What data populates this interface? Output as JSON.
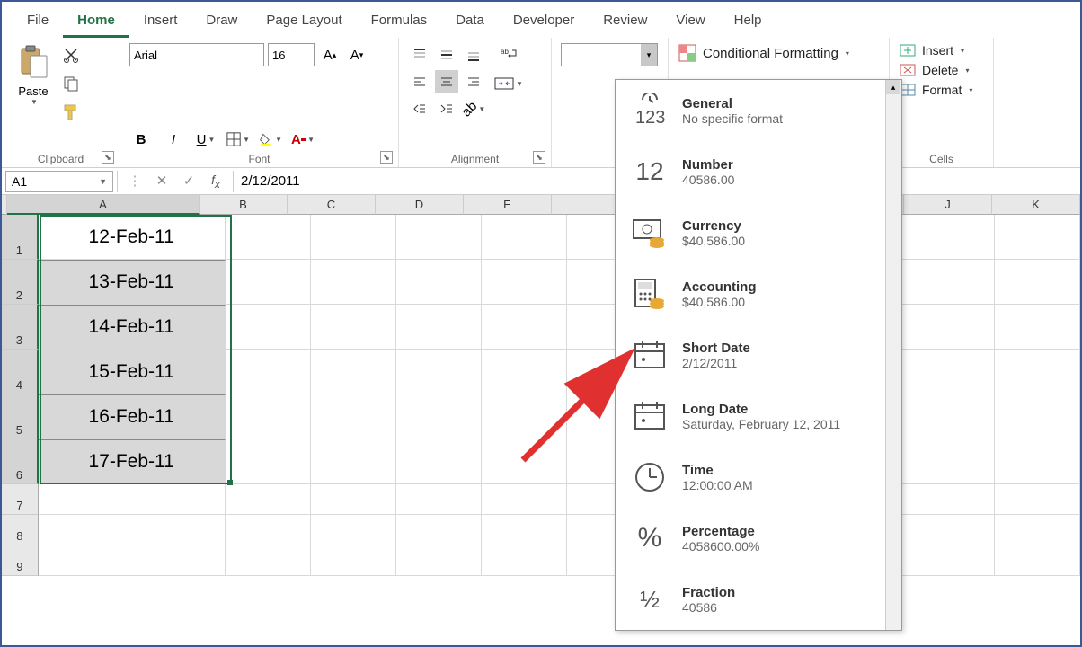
{
  "ribbon_tabs": [
    "File",
    "Home",
    "Insert",
    "Draw",
    "Page Layout",
    "Formulas",
    "Data",
    "Developer",
    "Review",
    "View",
    "Help"
  ],
  "active_tab": "Home",
  "clipboard": {
    "paste_label": "Paste",
    "group_label": "Clipboard"
  },
  "font": {
    "name": "Arial",
    "size": "16",
    "group_label": "Font"
  },
  "alignment": {
    "group_label": "Alignment"
  },
  "styles": {
    "cond_fmt": "Conditional Formatting",
    "group_label": ""
  },
  "cells": {
    "insert": "Insert",
    "delete": "Delete",
    "format": "Format",
    "group_label": "Cells"
  },
  "name_box": "A1",
  "formula_value": "2/12/2011",
  "columns": [
    "A",
    "B",
    "C",
    "D",
    "E",
    "",
    "",
    "",
    "",
    "J",
    "K"
  ],
  "rows": [
    {
      "n": "1",
      "a": "12-Feb-11"
    },
    {
      "n": "2",
      "a": "13-Feb-11"
    },
    {
      "n": "3",
      "a": "14-Feb-11"
    },
    {
      "n": "4",
      "a": "15-Feb-11"
    },
    {
      "n": "5",
      "a": "16-Feb-11"
    },
    {
      "n": "6",
      "a": "17-Feb-11"
    },
    {
      "n": "7",
      "a": ""
    },
    {
      "n": "8",
      "a": ""
    },
    {
      "n": "9",
      "a": ""
    }
  ],
  "numfmt_items": [
    {
      "icon": "123",
      "title": "General",
      "sub": "No specific format"
    },
    {
      "icon": "12",
      "title": "Number",
      "sub": "40586.00"
    },
    {
      "icon": "currency",
      "title": "Currency",
      "sub": "$40,586.00"
    },
    {
      "icon": "accounting",
      "title": "Accounting",
      "sub": " $40,586.00"
    },
    {
      "icon": "caldot",
      "title": "Short Date",
      "sub": "2/12/2011"
    },
    {
      "icon": "caldot",
      "title": "Long Date",
      "sub": "Saturday, February 12, 2011"
    },
    {
      "icon": "clock",
      "title": "Time",
      "sub": "12:00:00 AM"
    },
    {
      "icon": "percent",
      "title": "Percentage",
      "sub": "4058600.00%"
    },
    {
      "icon": "frac",
      "title": "Fraction",
      "sub": "40586"
    }
  ]
}
